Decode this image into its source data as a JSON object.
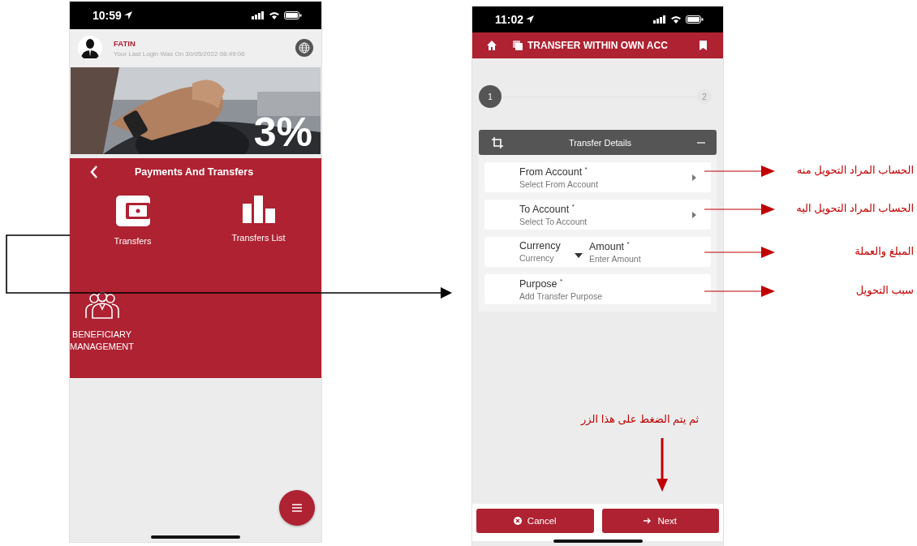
{
  "left_screen": {
    "status_bar": {
      "time": "10:59"
    },
    "profile": {
      "name": "FATIN",
      "last_login": "Your Last Login Was On 30/05/2022 08:49:06"
    },
    "banner": {
      "kind": "picture",
      "overlay_text": "3%"
    },
    "section": {
      "title": "Payments And Transfers",
      "tiles": [
        {
          "label": "Transfers",
          "kind": "wallet"
        },
        {
          "label": "Transfers List",
          "kind": "bars"
        },
        {
          "label": "BENEFICIARY MANAGEMENT",
          "kind": "people"
        }
      ]
    }
  },
  "right_screen": {
    "status_bar": {
      "time": "11:02"
    },
    "header": {
      "title": "TRANSFER WITHIN OWN ACC"
    },
    "stepper": {
      "steps": [
        {
          "label": "1",
          "selected": true
        },
        {
          "label": "2",
          "selected": false
        }
      ]
    },
    "panel": {
      "title": "Transfer Details",
      "expanded": true
    },
    "fields": [
      {
        "kind": "select",
        "label": "From Account $^{*}$",
        "placeholder": "Select From Account"
      },
      {
        "kind": "select",
        "label": "To Account $^{*}$",
        "placeholder": "Select To Account"
      },
      {
        "kind": "pair",
        "parts": [
          {
            "kind": "dropdown",
            "label": "Currency",
            "placeholder": "Currency"
          },
          {
            "kind": "text",
            "label": "Amount $^{*}$",
            "placeholder": "Enter Amount"
          }
        ]
      },
      {
        "kind": "text",
        "label": "Purpose $^{*}$",
        "placeholder": "Add Transfer Purpose"
      }
    ],
    "buttons": [
      {
        "label": "Cancel",
        "kind": "cancel"
      },
      {
        "label": "Next",
        "kind": "next"
      }
    ]
  },
  "annotations": [
    "الحساب المراد التحويل منه",
    "الحساب المراد التحويل اليه",
    "المبلغ والعملة",
    "سبب التحويل"
  ],
  "next_note": "ثم يتم الضغط على هذا الزر"
}
